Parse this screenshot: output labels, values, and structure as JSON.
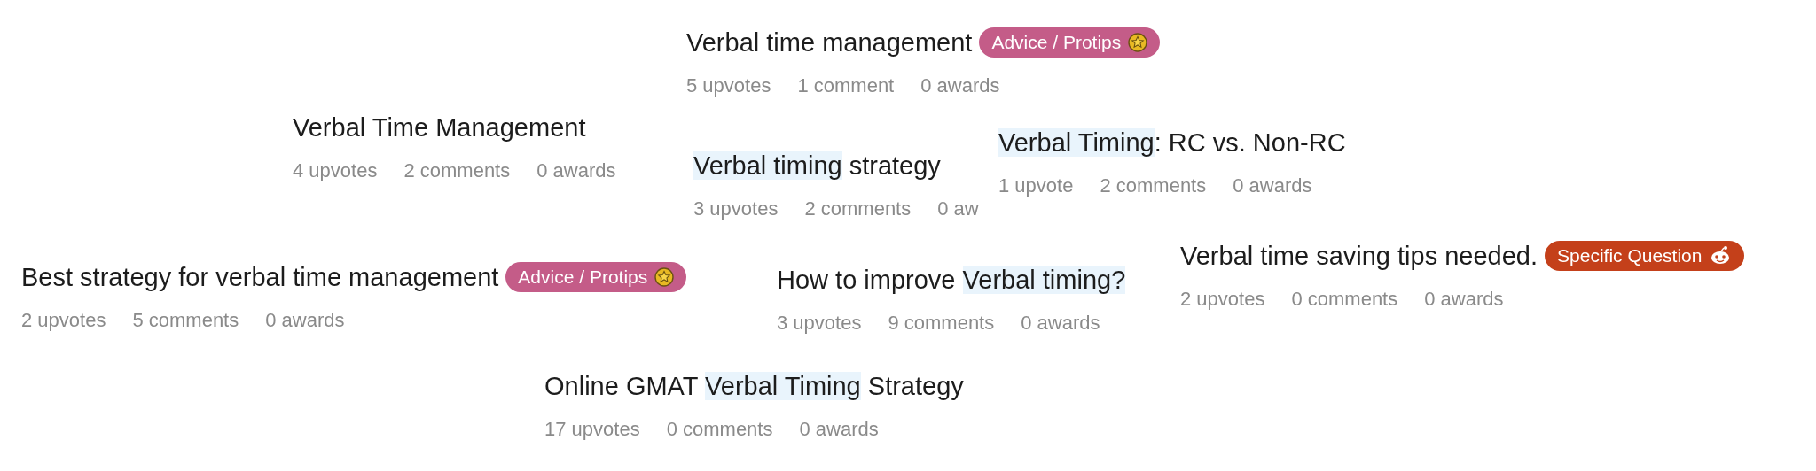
{
  "posts": [
    {
      "title_parts": [
        {
          "text": "Verbal time management",
          "highlighted": false
        }
      ],
      "flair": {
        "text": "Advice / Protips",
        "kind": "coin",
        "color": "#c45c88"
      },
      "upvotes": "5 upvotes",
      "comments": "1 comment",
      "awards": "0 awards"
    },
    {
      "title_parts": [
        {
          "text": "Verbal Time Management",
          "highlighted": false
        }
      ],
      "upvotes": "4 upvotes",
      "comments": "2 comments",
      "awards": "0 awards"
    },
    {
      "title_parts": [
        {
          "text": "Verbal timing",
          "highlighted": true
        },
        {
          "text": " strategy",
          "highlighted": false
        }
      ],
      "upvotes": "3 upvotes",
      "comments": "2 comments",
      "awards": "0 aw"
    },
    {
      "title_parts": [
        {
          "text": "Verbal Timing",
          "highlighted": true
        },
        {
          "text": ": RC vs. Non-RC",
          "highlighted": false
        }
      ],
      "upvotes": "1 upvote",
      "comments": "2 comments",
      "awards": "0 awards"
    },
    {
      "title_parts": [
        {
          "text": "Best strategy for verbal time management",
          "highlighted": false
        }
      ],
      "flair": {
        "text": "Advice / Protips",
        "kind": "coin",
        "color": "#c45c88"
      },
      "upvotes": "2 upvotes",
      "comments": "5 comments",
      "awards": "0 awards"
    },
    {
      "title_parts": [
        {
          "text": "How to improve ",
          "highlighted": false
        },
        {
          "text": "Verbal timing?",
          "highlighted": true
        }
      ],
      "upvotes": "3 upvotes",
      "comments": "9 comments",
      "awards": "0 awards"
    },
    {
      "title_parts": [
        {
          "text": "Verbal time saving tips needed.",
          "highlighted": false
        }
      ],
      "flair": {
        "text": "Specific Question",
        "kind": "mascot",
        "color": "#c4401a"
      },
      "upvotes": "2 upvotes",
      "comments": "0 comments",
      "awards": "0 awards"
    },
    {
      "title_parts": [
        {
          "text": "Online GMAT ",
          "highlighted": false
        },
        {
          "text": "Verbal Timing",
          "highlighted": true
        },
        {
          "text": " Strategy",
          "highlighted": false
        }
      ],
      "upvotes": "17 upvotes",
      "comments": "0 comments",
      "awards": "0 awards"
    }
  ]
}
